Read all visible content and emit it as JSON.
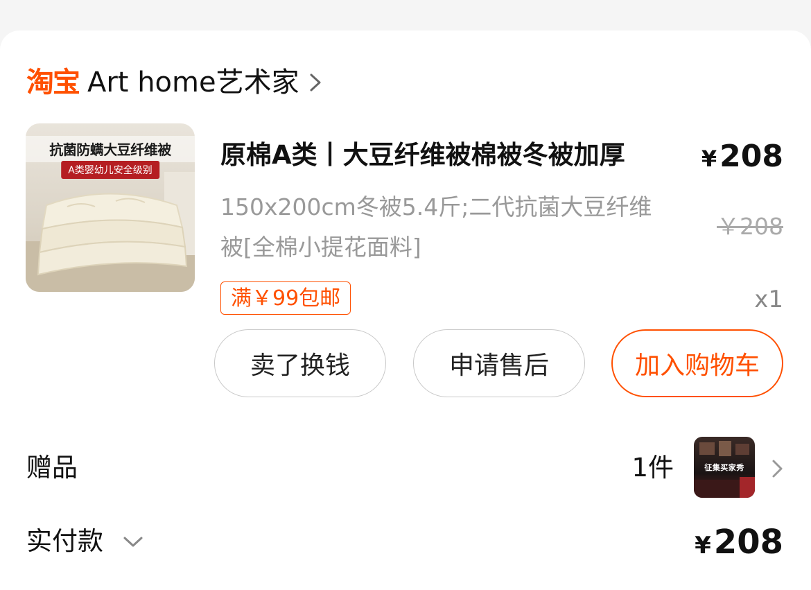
{
  "shop": {
    "platform_logo": "淘宝",
    "name": "Art home艺术家",
    "chevron_icon": "chevron-right-icon",
    "brand_color": "#ff5000"
  },
  "product": {
    "image_title": "抗菌防螨大豆纤维被",
    "image_subtitle": "A类婴幼儿安全级别",
    "title": "原棉A类丨大豆纤维被棉被冬被加厚",
    "price_symbol": "¥",
    "price": "208",
    "spec": "150x200cm冬被5.4斤;二代抗菌大豆纤维被[全棉小提花面料]",
    "original_price": "￥208",
    "promo_tag": "满￥99包邮",
    "quantity": "x1"
  },
  "actions": {
    "sell_label": "卖了换钱",
    "after_sale_label": "申请售后",
    "add_to_cart_label": "加入购物车"
  },
  "gift": {
    "label": "赠品",
    "count": "1件",
    "image_text": "征集买家秀",
    "chevron_icon": "chevron-right-icon"
  },
  "payment": {
    "label": "实付款",
    "expand_icon": "chevron-down-icon",
    "price_symbol": "¥",
    "amount": "208"
  }
}
